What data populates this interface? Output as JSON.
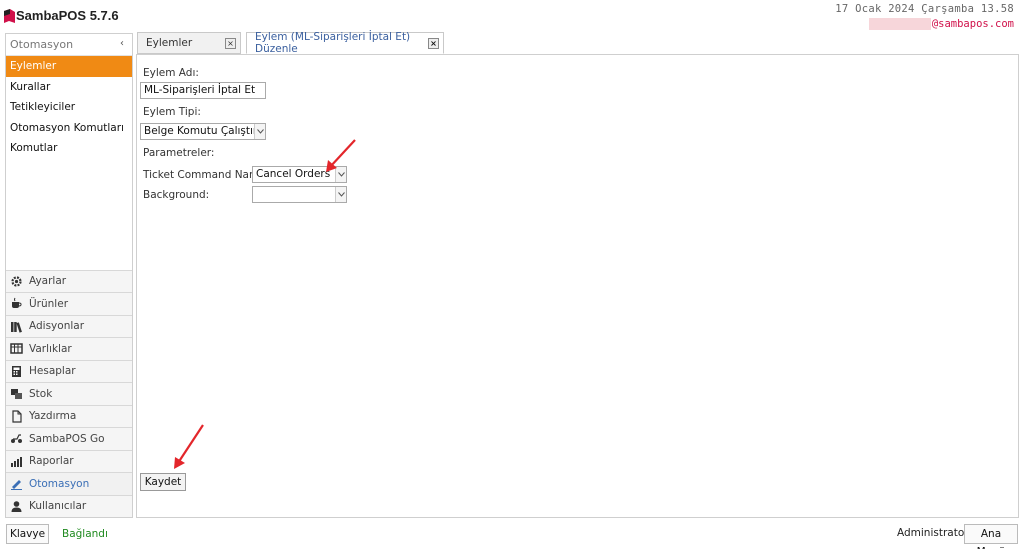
{
  "app": {
    "title": "SambaPOS 5.7.6",
    "datetime": "17 Ocak 2024 Çarşamba 13.58",
    "email": "@sambapos.com",
    "brand_color": "#d0114a",
    "accent_color": "#f08a14"
  },
  "sidebar": {
    "header": "Otomasyon",
    "collapse_icon": "‹",
    "items": [
      {
        "label": "Eylemler",
        "active": true
      },
      {
        "label": "Kurallar"
      },
      {
        "label": "Tetikleyiciler"
      },
      {
        "label": "Otomasyon Komutları"
      },
      {
        "label": "Komutlar"
      }
    ],
    "nav": [
      {
        "label": "Ayarlar",
        "icon": "gear-icon"
      },
      {
        "label": "Ürünler",
        "icon": "coffee-icon"
      },
      {
        "label": "Adisyonlar",
        "icon": "books-icon"
      },
      {
        "label": "Varlıklar",
        "icon": "table-icon"
      },
      {
        "label": "Hesaplar",
        "icon": "calculator-icon"
      },
      {
        "label": "Stok",
        "icon": "stock-icon"
      },
      {
        "label": "Yazdırma",
        "icon": "document-icon"
      },
      {
        "label": "SambaPOS Go",
        "icon": "scooter-icon"
      },
      {
        "label": "Raporlar",
        "icon": "bar-chart-icon"
      },
      {
        "label": "Otomasyon",
        "icon": "pencil-icon",
        "active": true
      },
      {
        "label": "Kullanıcılar",
        "icon": "user-icon"
      }
    ]
  },
  "tabs": [
    {
      "label": "Eylemler",
      "close": "×"
    },
    {
      "label": "Eylem (ML-Siparişleri İptal Et) Düzenle",
      "close": "×",
      "active": true
    }
  ],
  "form": {
    "name_label": "Eylem Adı:",
    "name_value": "ML-Siparişleri İptal Et",
    "type_label": "Eylem Tipi:",
    "type_value": "Belge Komutu Çalıştır",
    "params_label": "Parametreler:",
    "ticket_command_label": "Ticket Command Name:",
    "ticket_command_value": "Cancel Orders",
    "background_label": "Background:",
    "background_value": "",
    "save_label": "Kaydet"
  },
  "footer": {
    "keyboard_label": "Klavye",
    "status": "Bağlandı",
    "user": "Administrator",
    "main_menu_label": "Ana Menü"
  }
}
